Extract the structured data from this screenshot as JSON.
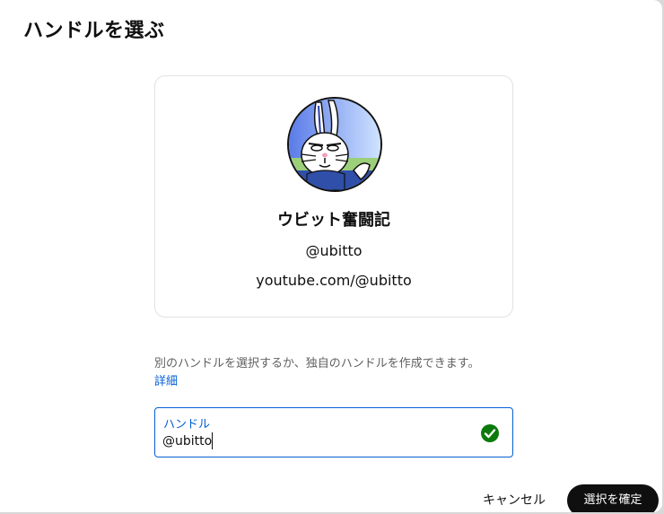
{
  "dialog": {
    "title": "ハンドルを選ぶ"
  },
  "channel": {
    "avatar_icon": "rabbit-avatar",
    "name": "ウビット奮闘記",
    "handle": "@ubitto",
    "url": "youtube.com/@ubitto"
  },
  "help": {
    "text": "別のハンドルを選択するか、独自のハンドルを作成できます。",
    "link_label": "詳細"
  },
  "handle_field": {
    "label": "ハンドル",
    "value": "@ubitto",
    "status_icon": "check-circle-icon",
    "status_color": "#0b7a0b"
  },
  "actions": {
    "cancel_label": "キャンセル",
    "confirm_label": "選択を確定"
  },
  "colors": {
    "accent": "#065fd4",
    "primary_button": "#0f0f0f"
  }
}
